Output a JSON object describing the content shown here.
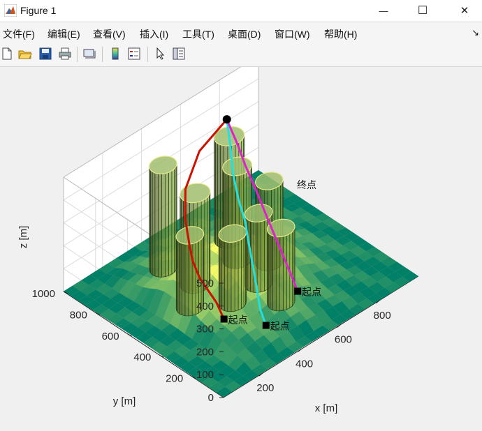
{
  "window": {
    "title": "Figure 1",
    "minimize_glyph": "—",
    "maximize_glyph": "☐",
    "close_glyph": "✕"
  },
  "menu": {
    "items": [
      "文件(F)",
      "编辑(E)",
      "查看(V)",
      "插入(I)",
      "工具(T)",
      "桌面(D)",
      "窗口(W)",
      "帮助(H)"
    ],
    "overflow_icon": "arrow-icon"
  },
  "toolbar": {
    "icons": [
      "new-figure-icon",
      "open-file-icon",
      "save-icon",
      "print-icon",
      "link-plot-icon",
      "colorbar-icon",
      "legend-icon",
      "pointer-icon",
      "property-inspector-icon"
    ]
  },
  "chart_data": {
    "type": "surface3d",
    "title": "",
    "xlabel": "x [m]",
    "ylabel": "y [m]",
    "zlabel": "z [m]",
    "xlim": [
      0,
      1000
    ],
    "ylim": [
      0,
      1000
    ],
    "zlim": [
      0,
      500
    ],
    "xticks": [
      200,
      400,
      600,
      800
    ],
    "yticks": [
      200,
      400,
      600,
      800,
      1000
    ],
    "zticks": [
      0,
      100,
      200,
      300,
      400,
      500
    ],
    "grid": true,
    "colormap": "summer",
    "terrain_z_range": [
      0,
      190
    ],
    "cylinders": [
      {
        "x": 330,
        "y": 780,
        "r": 55,
        "top_z": 480
      },
      {
        "x": 620,
        "y": 720,
        "r": 60,
        "top_z": 480
      },
      {
        "x": 330,
        "y": 580,
        "r": 60,
        "top_z": 450
      },
      {
        "x": 530,
        "y": 560,
        "r": 58,
        "top_z": 470
      },
      {
        "x": 230,
        "y": 490,
        "r": 55,
        "top_z": 360
      },
      {
        "x": 500,
        "y": 390,
        "r": 55,
        "top_z": 360
      },
      {
        "x": 350,
        "y": 370,
        "r": 55,
        "top_z": 360
      },
      {
        "x": 620,
        "y": 470,
        "r": 55,
        "top_z": 400
      },
      {
        "x": 500,
        "y": 250,
        "r": 55,
        "top_z": 360
      }
    ],
    "series": [
      {
        "color": "#cc1100",
        "start_label": "起点",
        "start": [
          150,
          180,
          180
        ],
        "end": [
          690,
          820,
          470
        ],
        "points": [
          [
            150,
            180,
            180
          ],
          [
            160,
            240,
            220
          ],
          [
            140,
            320,
            300
          ],
          [
            145,
            370,
            350
          ],
          [
            170,
            420,
            380
          ],
          [
            230,
            520,
            420
          ],
          [
            330,
            640,
            440
          ],
          [
            500,
            760,
            460
          ],
          [
            690,
            820,
            470
          ]
        ]
      },
      {
        "color": "#22e0e0",
        "start_label": "起点",
        "start": [
          300,
          100,
          110
        ],
        "end": [
          690,
          820,
          470
        ],
        "points": [
          [
            300,
            100,
            110
          ],
          [
            320,
            160,
            140
          ],
          [
            360,
            250,
            250
          ],
          [
            400,
            330,
            310
          ],
          [
            440,
            400,
            350
          ],
          [
            480,
            490,
            380
          ],
          [
            540,
            600,
            420
          ],
          [
            610,
            700,
            450
          ],
          [
            690,
            820,
            470
          ]
        ]
      },
      {
        "color": "#dd22cc",
        "start_label": "起点",
        "start": [
          520,
          170,
          110
        ],
        "end": [
          690,
          820,
          470
        ],
        "end_label": "终点",
        "points": [
          [
            520,
            170,
            110
          ],
          [
            530,
            230,
            160
          ],
          [
            545,
            320,
            230
          ],
          [
            560,
            410,
            300
          ],
          [
            590,
            520,
            360
          ],
          [
            620,
            620,
            400
          ],
          [
            650,
            700,
            430
          ],
          [
            690,
            820,
            470
          ]
        ]
      }
    ]
  }
}
